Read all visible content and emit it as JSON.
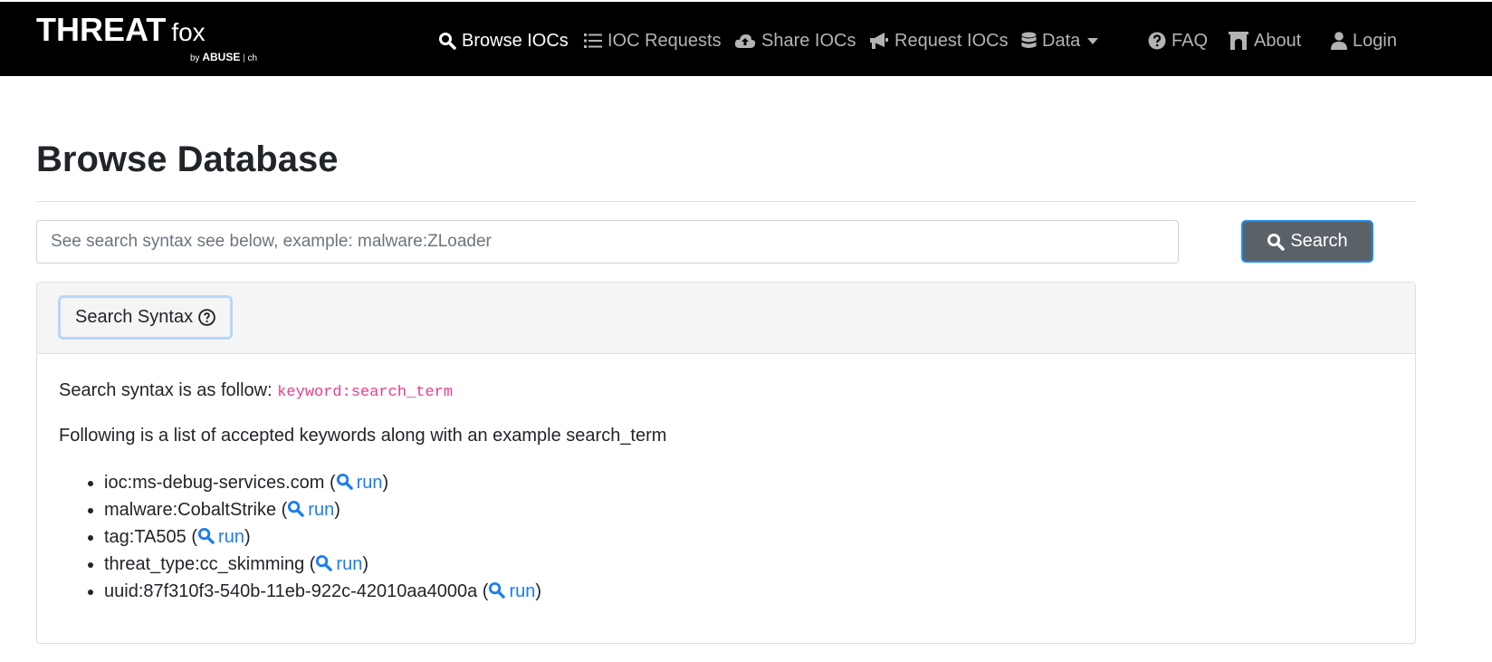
{
  "brand": {
    "name": "THREAT",
    "sub": "fox",
    "by": "by",
    "org": "ABUSE",
    "org_suffix": "ch"
  },
  "nav": [
    {
      "label": "Browse IOCs",
      "icon": "search-icon",
      "active": true
    },
    {
      "label": "IOC Requests",
      "icon": "list-icon",
      "active": false
    },
    {
      "label": "Share IOCs",
      "icon": "cloud-upload-icon",
      "active": false
    },
    {
      "label": "Request IOCs",
      "icon": "bullhorn-icon",
      "active": false
    },
    {
      "label": "Data",
      "icon": "database-icon",
      "active": false,
      "dropdown": true
    },
    {
      "label": "FAQ",
      "icon": "question-circle-icon",
      "active": false
    },
    {
      "label": "About",
      "icon": "archway-icon",
      "active": false
    },
    {
      "label": "Login",
      "icon": "user-icon",
      "active": false
    }
  ],
  "page": {
    "title": "Browse Database"
  },
  "search": {
    "placeholder": "See search syntax see below, example: malware:ZLoader",
    "value": "",
    "button_label": "Search"
  },
  "syntax_card": {
    "toggle_label": "Search Syntax",
    "intro_prefix": "Search syntax is as follow: ",
    "intro_code": "keyword:search_term",
    "list_intro": "Following is a list of accepted keywords along with an example search_term",
    "run_label": "run",
    "examples": [
      "ioc:ms-debug-services.com",
      "malware:CobaltStrike",
      "tag:TA505",
      "threat_type:cc_skimming",
      "uuid:87f310f3-540b-11eb-922c-42010aa4000a"
    ]
  },
  "colors": {
    "navbar": "#000000",
    "link": "#1a7ef0",
    "code": "#e83e8c",
    "search_button": "#5a6268"
  }
}
